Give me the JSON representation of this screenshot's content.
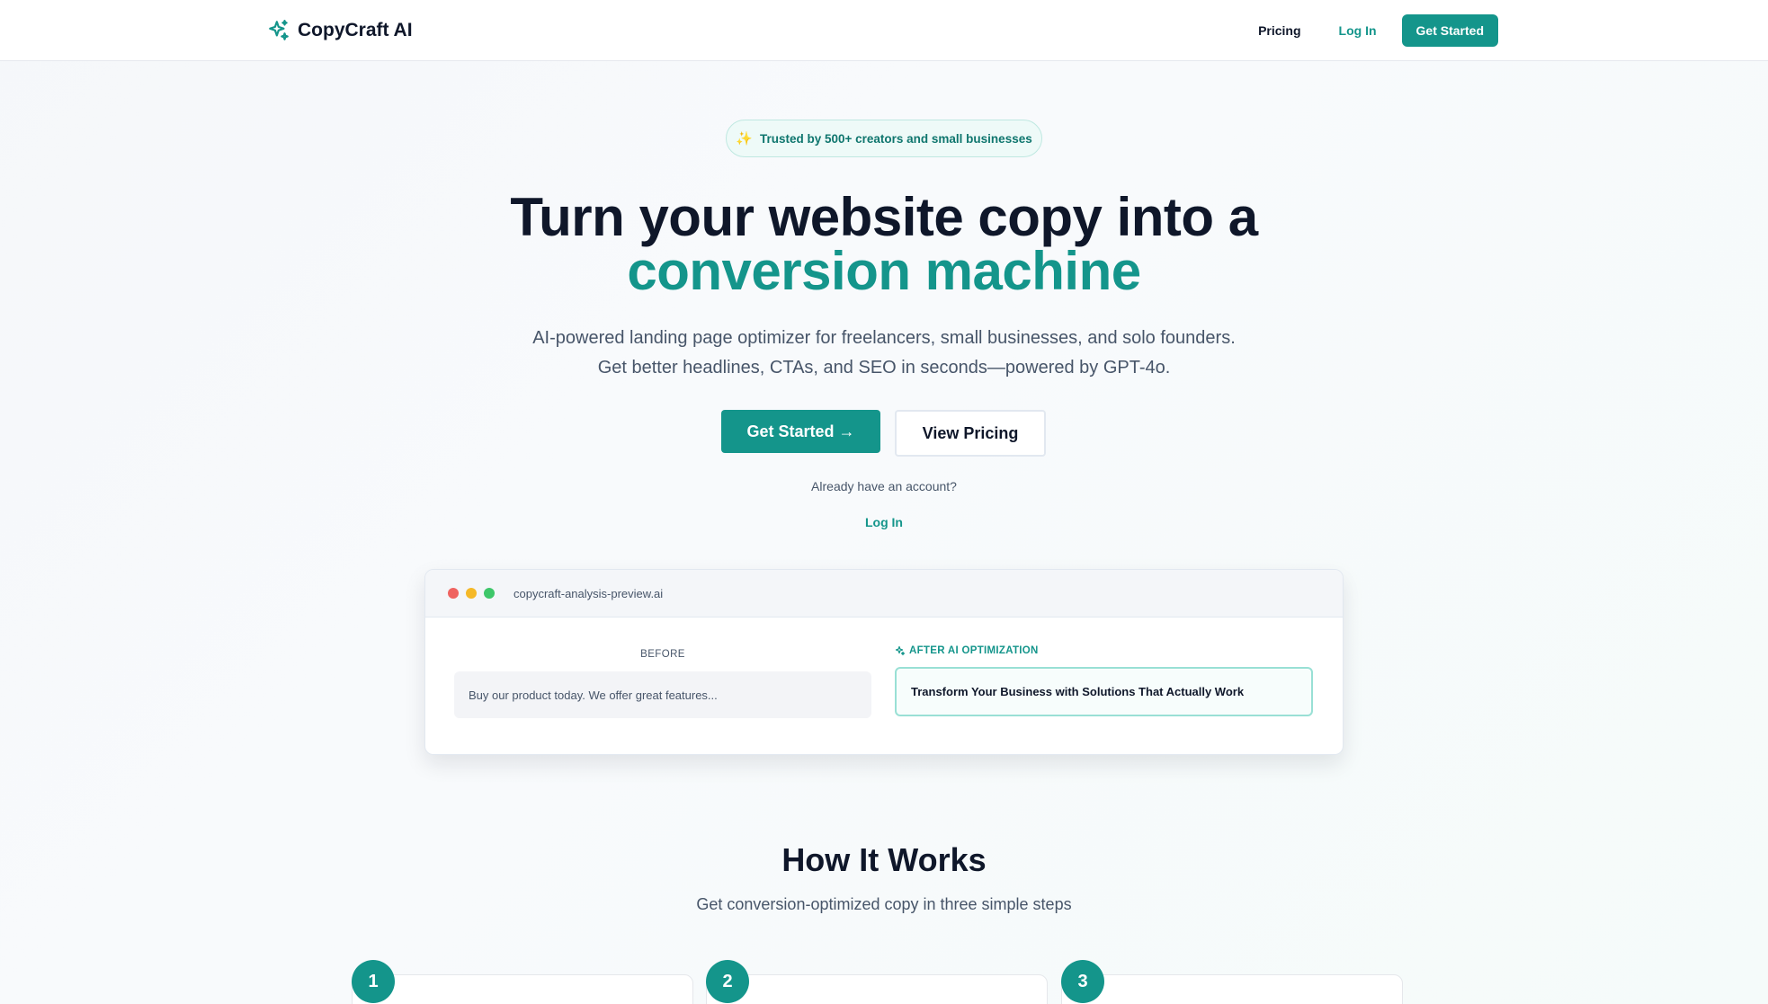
{
  "header": {
    "brand": "CopyCraft AI",
    "nav": {
      "pricing": "Pricing",
      "login": "Log In",
      "cta": "Get Started"
    }
  },
  "hero": {
    "badge": "Trusted by 500+ creators and small businesses",
    "title_line1": "Turn your website copy into a",
    "title_accent": "conversion machine",
    "subtitle": "AI-powered landing page optimizer for freelancers, small businesses, and solo founders. Get better headlines, CTAs, and SEO in seconds—powered by GPT-4o.",
    "primary_cta": "Get Started →",
    "secondary_cta": "View Pricing",
    "account_prompt": "Already have an account?",
    "login_link": "Log In"
  },
  "preview": {
    "url": "copycraft-analysis-preview.ai",
    "before_label": "BEFORE",
    "before_text": "Buy our product today. We offer great features...",
    "after_label": "AFTER AI OPTIMIZATION",
    "after_text": "Transform Your Business with Solutions That Actually Work"
  },
  "how_it_works": {
    "title": "How It Works",
    "subtitle": "Get conversion-optimized copy in three simple steps",
    "steps": [
      "1",
      "2",
      "3"
    ]
  },
  "colors": {
    "accent": "#14958b",
    "dot_red": "#ef6461",
    "dot_yellow": "#f5b928",
    "dot_green": "#3ec76a"
  },
  "icons": {
    "brand": "sparkle-icon",
    "badge": "sparkle-icon",
    "after_label": "sparkle-icon"
  }
}
